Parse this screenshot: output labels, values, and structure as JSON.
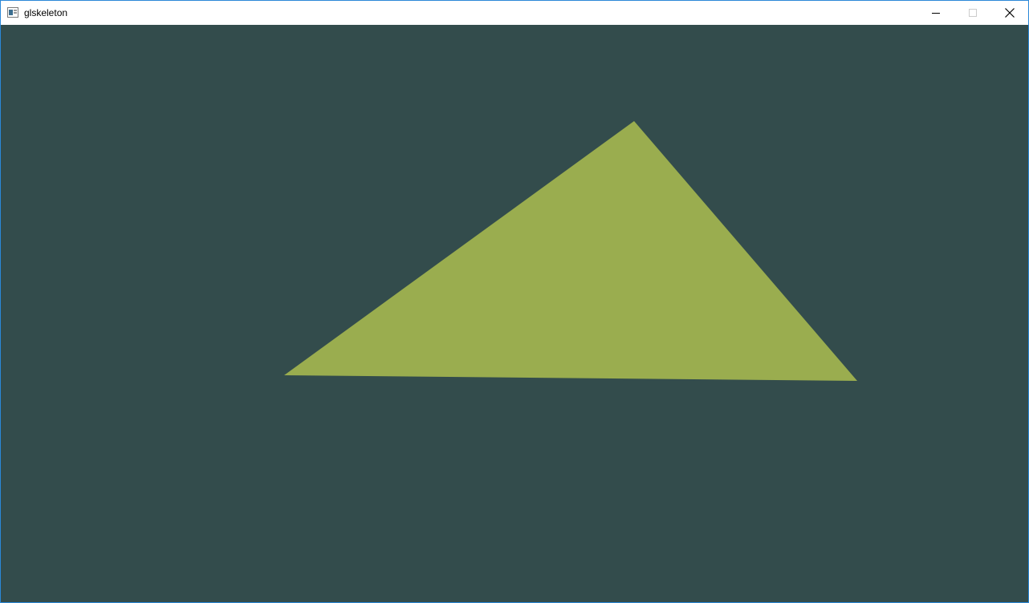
{
  "window": {
    "title": "glskeleton",
    "controls": {
      "minimize_icon": "minimize-icon",
      "maximize_icon": "maximize-icon",
      "close_icon": "close-icon",
      "maximize_enabled": false
    }
  },
  "viewport": {
    "clear_color": "#334c4c",
    "triangle_color": "#9aad4f",
    "shapes": [
      "triangle"
    ]
  },
  "colors": {
    "window_border": "#2b88d8",
    "titlebar_bg": "#ffffff",
    "title_text": "#000000",
    "disabled_control": "#cccccc"
  }
}
